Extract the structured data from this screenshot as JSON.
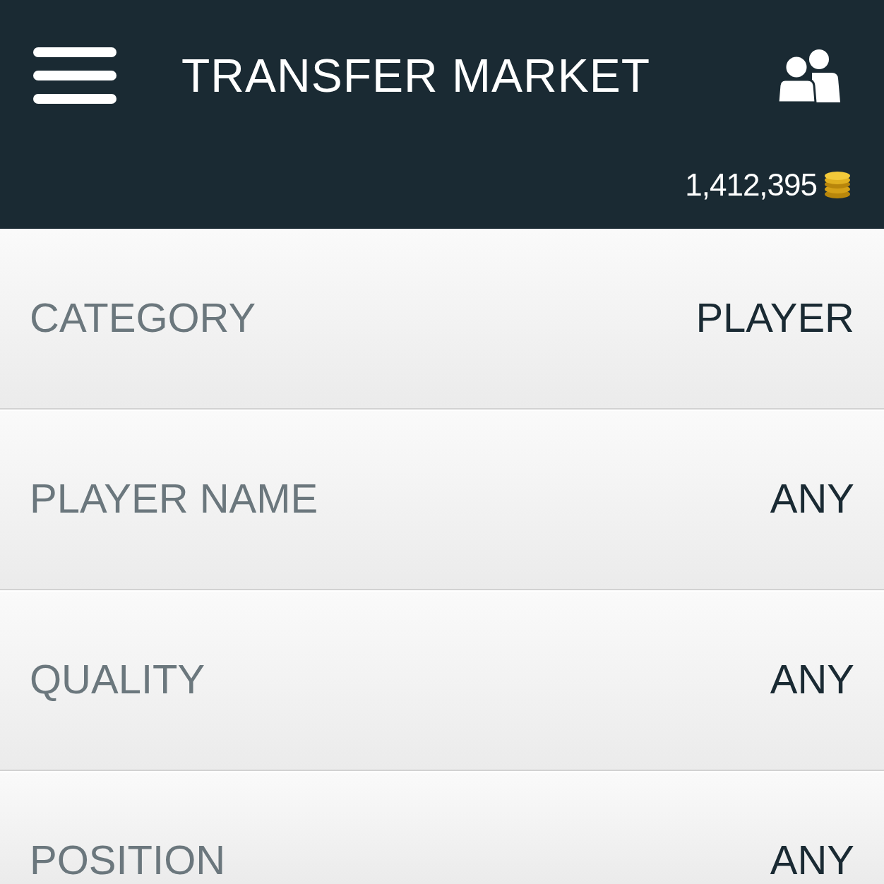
{
  "header": {
    "title": "TRANSFER MARKET",
    "coins": "1,412,395"
  },
  "filters": [
    {
      "label": "CATEGORY",
      "value": "PLAYER"
    },
    {
      "label": "PLAYER NAME",
      "value": "ANY"
    },
    {
      "label": "QUALITY",
      "value": "ANY"
    },
    {
      "label": "POSITION",
      "value": "ANY"
    }
  ]
}
